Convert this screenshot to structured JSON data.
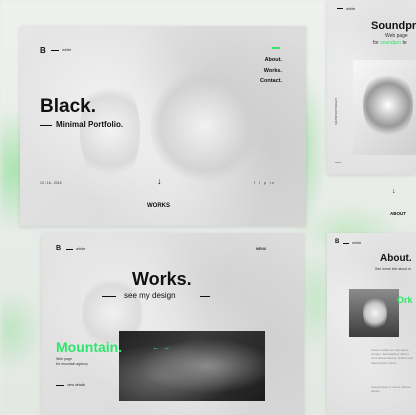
{
  "main": {
    "logo_letter": "B",
    "logo_word": "white",
    "nav": [
      "About.",
      "Works.",
      "Contact."
    ],
    "title": "Black.",
    "subtitle": "Minimal Portfolio.",
    "date": "12 / 16 - 2015",
    "social": "f  t  p  in",
    "scroll_arrow": "↓",
    "works_label": "WORKS"
  },
  "works_card": {
    "logo_letter": "B",
    "logo_word": "white",
    "menu": "MENU",
    "title": "Works.",
    "subtitle": "see my design",
    "project": "Mountain.",
    "arrows": "← →",
    "desc1": "Web page",
    "desc2": "for mountain agency",
    "view": "view details"
  },
  "sound_card": {
    "logo_word": "white",
    "title": "Soundpr",
    "sub1": "Web page",
    "sub2_plain": "for ",
    "sub2_green": "soundpro",
    "sub2_tail": " te",
    "side_label": "SOUNDPRO PROJECT",
    "scroll_arrow": "↓",
    "about_label": "ABOUT"
  },
  "about_card": {
    "logo_word": "white",
    "title": "About.",
    "subtitle": "See some info about m",
    "green_word": "Ork",
    "paragraph1": "Fusce a tellus ac velit varius congue. Sed dapibus nibh ut urna lacinia laoreet. Nullam sed ullamcorper mauris.",
    "paragraph2": "Suspendisse in metus ultrices sapien."
  },
  "colors": {
    "accent": "#2ee66b",
    "text": "#111111"
  }
}
